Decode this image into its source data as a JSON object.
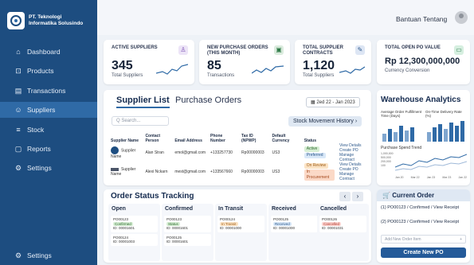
{
  "brand": {
    "name_line1": "PT. Teknologi",
    "name_line2": "Informatika Solusindo"
  },
  "sidebar": {
    "items": [
      {
        "label": "Dashboard",
        "icon": "home-icon"
      },
      {
        "label": "Products",
        "icon": "box-icon"
      },
      {
        "label": "Transactions",
        "icon": "receipt-icon"
      },
      {
        "label": "Suppliers",
        "icon": "users-icon"
      },
      {
        "label": "Stock",
        "icon": "stack-icon"
      },
      {
        "label": "Reports",
        "icon": "report-icon"
      },
      {
        "label": "Settings",
        "icon": "gear-icon"
      }
    ],
    "footer_settings": "Settings"
  },
  "topbar": {
    "help": "Bantuan",
    "about": "Tentang"
  },
  "stats": [
    {
      "label": "ACTIVE SUPPLIERS",
      "value": "345",
      "sub": "Total Suppliers",
      "icon": "users-icon"
    },
    {
      "label_l1": "NEW PURCHASE ORDERS",
      "label_l2": "(THIS MONTH)",
      "value": "85",
      "sub": "Transactions",
      "icon": "document-icon"
    },
    {
      "label_l1": "TOTAL SUPPLIER",
      "label_l2": "CONTRACTS",
      "value": "1,120",
      "sub": "Total Suppliers",
      "icon": "contract-icon"
    },
    {
      "label": "TOTAL OPEN PO VALUE",
      "value": "Rp 12,300,000,000",
      "sub": "Currency Conversion",
      "icon": "cash-icon"
    }
  ],
  "supplier": {
    "tab_list": "Supplier List",
    "tab_orders": "Purchase Orders",
    "date_range": "2ed 22 - Jan 2023",
    "search_placeholder": "Q Search...",
    "stock_history": "Stock Movement History",
    "headers": [
      "Supplier Name",
      "Contact Person",
      "Email Address",
      "Phone Number",
      "Tax ID (NPWP)",
      "Default Currency",
      "Status"
    ],
    "rows": [
      {
        "name": "Supplier Name",
        "contact": "Alan Stran",
        "email": "emol@gmail.com",
        "phone": "+133257730",
        "tax": "Rp00000003",
        "currency": "US3",
        "status1": "Active",
        "status2": "Preferred",
        "actions": [
          "View Details",
          "Create PO",
          "Manage Contract"
        ]
      },
      {
        "name": "Supplier Name",
        "contact": "Alexi Nckarn",
        "email": "mest@gmail.com",
        "phone": "+133567660",
        "tax": "Rp00000003",
        "currency": "US3",
        "status1": "On Review",
        "status2": "In Procurement",
        "actions": [
          "View Details",
          "Create PO",
          "Manage Contract"
        ]
      }
    ]
  },
  "warehouse": {
    "title": "Warehouse Analytics",
    "metric1": "Average Order Fulfillment Time (Days)",
    "metric2": "On-Time Delivery Rate (%)",
    "trend_title": "Purchase Spend Trend",
    "trend_y_ticks": [
      "1,000,000",
      "500,000",
      "200,000",
      "100"
    ],
    "trend_x_ticks": [
      "Jan 20",
      "Mar 22",
      "Jan 23",
      "Mar 23",
      "Jan 22"
    ]
  },
  "order_tracking": {
    "title": "Order Status Tracking",
    "columns": [
      {
        "name": "Open",
        "cards": [
          {
            "id": "PO00123",
            "tag": "Confirmed",
            "meta": "ID: 00001601"
          },
          {
            "id": "PO00124",
            "tag": "",
            "meta": "ID: 00001003"
          }
        ]
      },
      {
        "name": "Confirmed",
        "cards": [
          {
            "id": "PO00123",
            "tag": "Status",
            "meta": "ID: 00001601"
          },
          {
            "id": "PO00125",
            "tag": "",
            "meta": "ID: 00001601"
          }
        ]
      },
      {
        "name": "In Transit",
        "cards": [
          {
            "id": "PO00124",
            "tag": "In Transit",
            "meta": "ID: 00001000"
          }
        ]
      },
      {
        "name": "Received",
        "cards": [
          {
            "id": "PO00125",
            "tag": "Received",
            "meta": "ID: 00001000"
          }
        ]
      },
      {
        "name": "Cancelled",
        "cards": [
          {
            "id": "PO00126",
            "tag": "Cancelled",
            "meta": "ID: 00001031"
          }
        ]
      }
    ]
  },
  "current_order": {
    "title": "Current Order",
    "lines": [
      "(1) PO00123 / Confirmed / View Receipt",
      "(2) PO00123 / Confirmed / View Receipt"
    ],
    "input_placeholder": "Add New Order Item",
    "button": "Create New PO"
  },
  "colors": {
    "sidebar": "#1d4d80",
    "accent": "#2f6aa6",
    "button": "#245a99"
  }
}
